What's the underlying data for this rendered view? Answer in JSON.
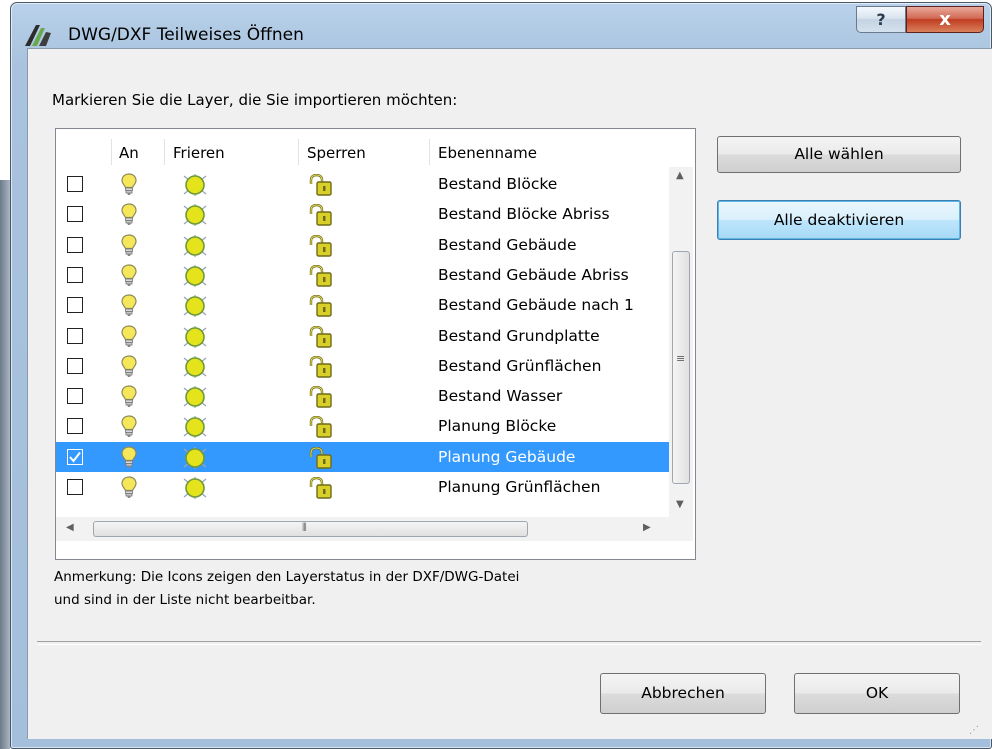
{
  "window": {
    "title": "DWG/DXF Teilweises Öffnen",
    "help_button": "?",
    "close_button": "x"
  },
  "instruction": "Markieren Sie die Layer, die Sie importieren möchten:",
  "columns": [
    "An",
    "Frieren",
    "Sperren",
    "Ebenenname"
  ],
  "layers": [
    {
      "name": "Bestand Blöcke",
      "checked": false,
      "selected": false
    },
    {
      "name": "Bestand Blöcke Abriss",
      "checked": false,
      "selected": false
    },
    {
      "name": "Bestand Gebäude",
      "checked": false,
      "selected": false
    },
    {
      "name": "Bestand Gebäude Abriss",
      "checked": false,
      "selected": false
    },
    {
      "name": "Bestand Gebäude nach 1",
      "checked": false,
      "selected": false
    },
    {
      "name": "Bestand Grundplatte",
      "checked": false,
      "selected": false
    },
    {
      "name": "Bestand Grünflächen",
      "checked": false,
      "selected": false
    },
    {
      "name": "Bestand Wasser",
      "checked": false,
      "selected": false
    },
    {
      "name": "Planung Blöcke",
      "checked": false,
      "selected": false
    },
    {
      "name": "Planung Gebäude",
      "checked": true,
      "selected": true
    },
    {
      "name": "Planung Grünflächen",
      "checked": false,
      "selected": false
    }
  ],
  "icons": {
    "on": "lightbulb-icon",
    "freeze": "sun-freeze-icon",
    "lock": "padlock-icon"
  },
  "buttons": {
    "select_all": "Alle wählen",
    "deselect_all": "Alle deaktivieren",
    "cancel": "Abbrechen",
    "ok": "OK"
  },
  "note": {
    "line1": "Anmerkung: Die Icons zeigen den Layerstatus in der DXF/DWG-Datei",
    "line2": "und sind in der Liste nicht bearbeitbar."
  },
  "colors": {
    "selection": "#3399ff",
    "bulb": "#f5e65a",
    "freeze": "#e4e31c",
    "lock": "#d8d028"
  }
}
